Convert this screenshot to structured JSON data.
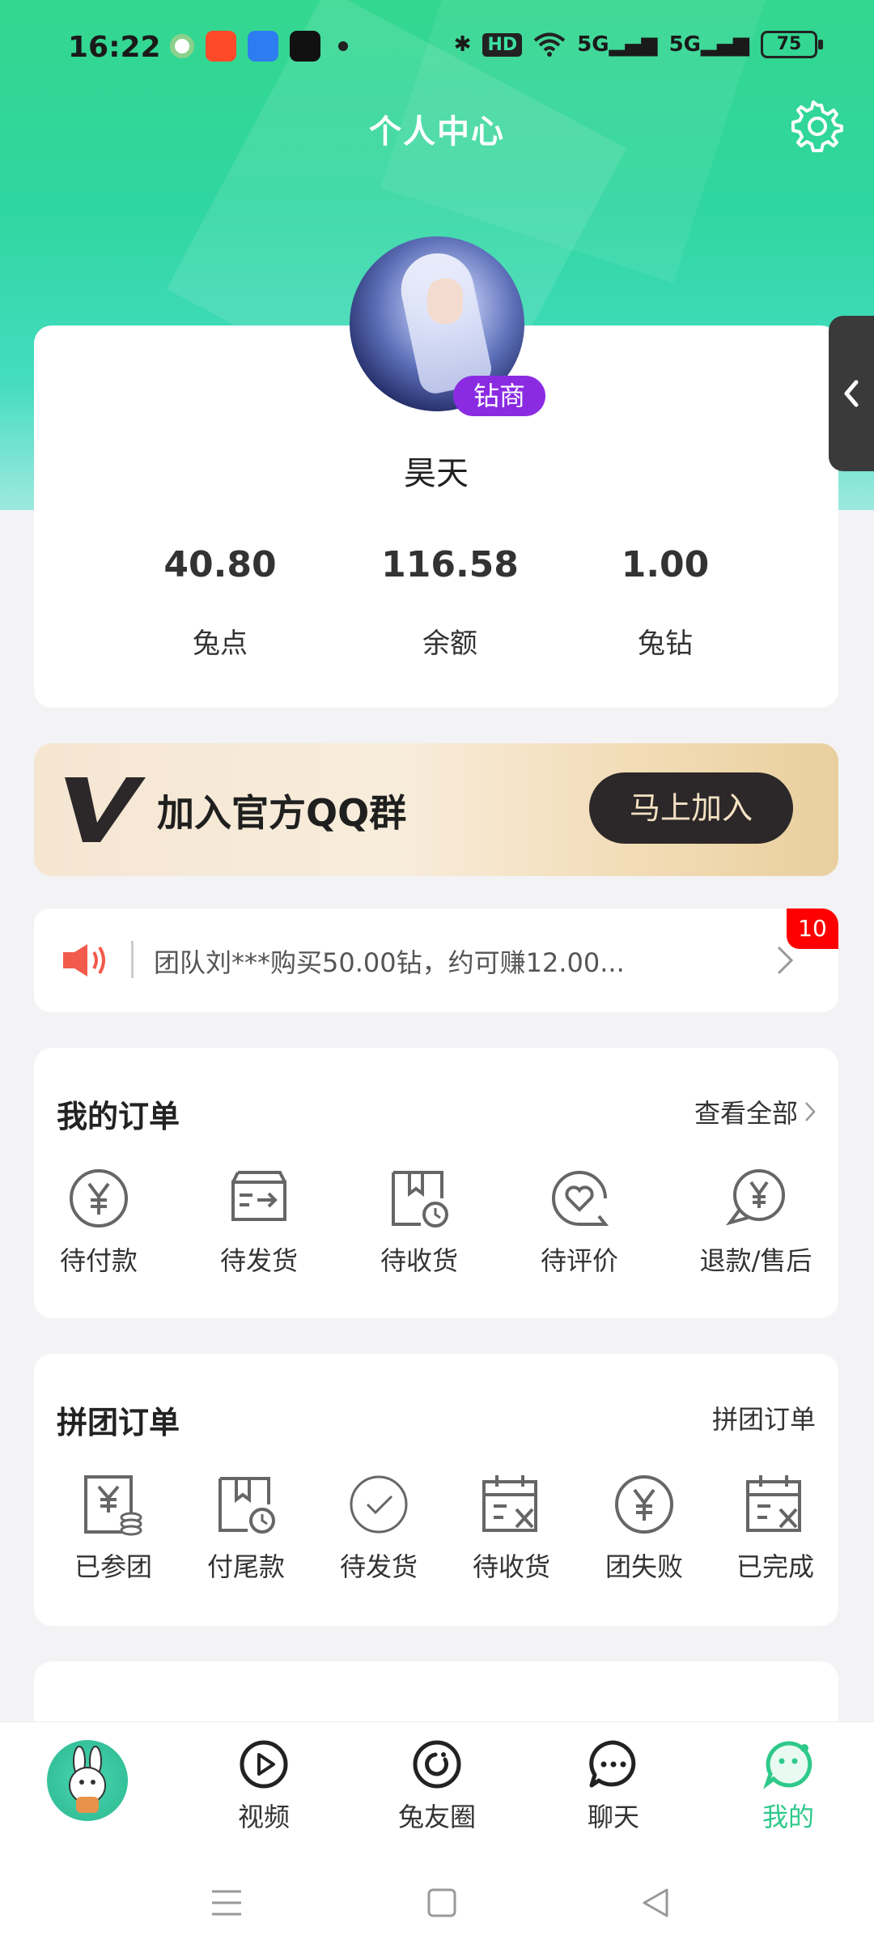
{
  "status_bar": {
    "time": "16:22",
    "network_5g_1": "5G",
    "network_5g_2": "5G",
    "hd": "HD",
    "battery": "75"
  },
  "header": {
    "title": "个人中心",
    "settings_icon": "gear-icon"
  },
  "profile": {
    "vip_badge": "钻商",
    "username": "昊天",
    "stats": [
      {
        "value": "40.80",
        "label": "兔点"
      },
      {
        "value": "116.58",
        "label": "余额"
      },
      {
        "value": "1.00",
        "label": "兔钻"
      }
    ]
  },
  "banner": {
    "text": "加入官方QQ群",
    "button": "马上加入"
  },
  "notice": {
    "text": "团队刘***购买50.00钻，约可赚12.00...",
    "badge": "10"
  },
  "my_orders": {
    "title": "我的订单",
    "link": "查看全部",
    "items": [
      {
        "label": "待付款",
        "icon": "yen-circle-icon"
      },
      {
        "label": "待发货",
        "icon": "box-send-icon"
      },
      {
        "label": "待收货",
        "icon": "package-clock-icon"
      },
      {
        "label": "待评价",
        "icon": "heart-comment-icon"
      },
      {
        "label": "退款/售后",
        "icon": "refund-bubble-icon"
      }
    ]
  },
  "group_orders": {
    "title": "拼团订单",
    "link": "拼团订单",
    "items": [
      {
        "label": "已参团",
        "icon": "yen-coins-icon"
      },
      {
        "label": "付尾款",
        "icon": "package-clock-icon"
      },
      {
        "label": "待发货",
        "icon": "check-circle-icon"
      },
      {
        "label": "待收货",
        "icon": "calendar-x-icon"
      },
      {
        "label": "团失败",
        "icon": "yen-circle-icon"
      },
      {
        "label": "已完成",
        "icon": "calendar-x-icon"
      }
    ]
  },
  "tab_bar": {
    "items": [
      {
        "label": "",
        "icon": "mascot-icon"
      },
      {
        "label": "视频",
        "icon": "play-circle-icon"
      },
      {
        "label": "兔友圈",
        "icon": "refresh-circle-icon"
      },
      {
        "label": "聊天",
        "icon": "chat-bubble-icon"
      },
      {
        "label": "我的",
        "icon": "smile-bubble-icon"
      }
    ],
    "active": "我的"
  },
  "colors": {
    "accent": "#2ec98a",
    "vip": "#8a2be2",
    "badge": "#ff0000",
    "banner_button": "#2c2829"
  }
}
